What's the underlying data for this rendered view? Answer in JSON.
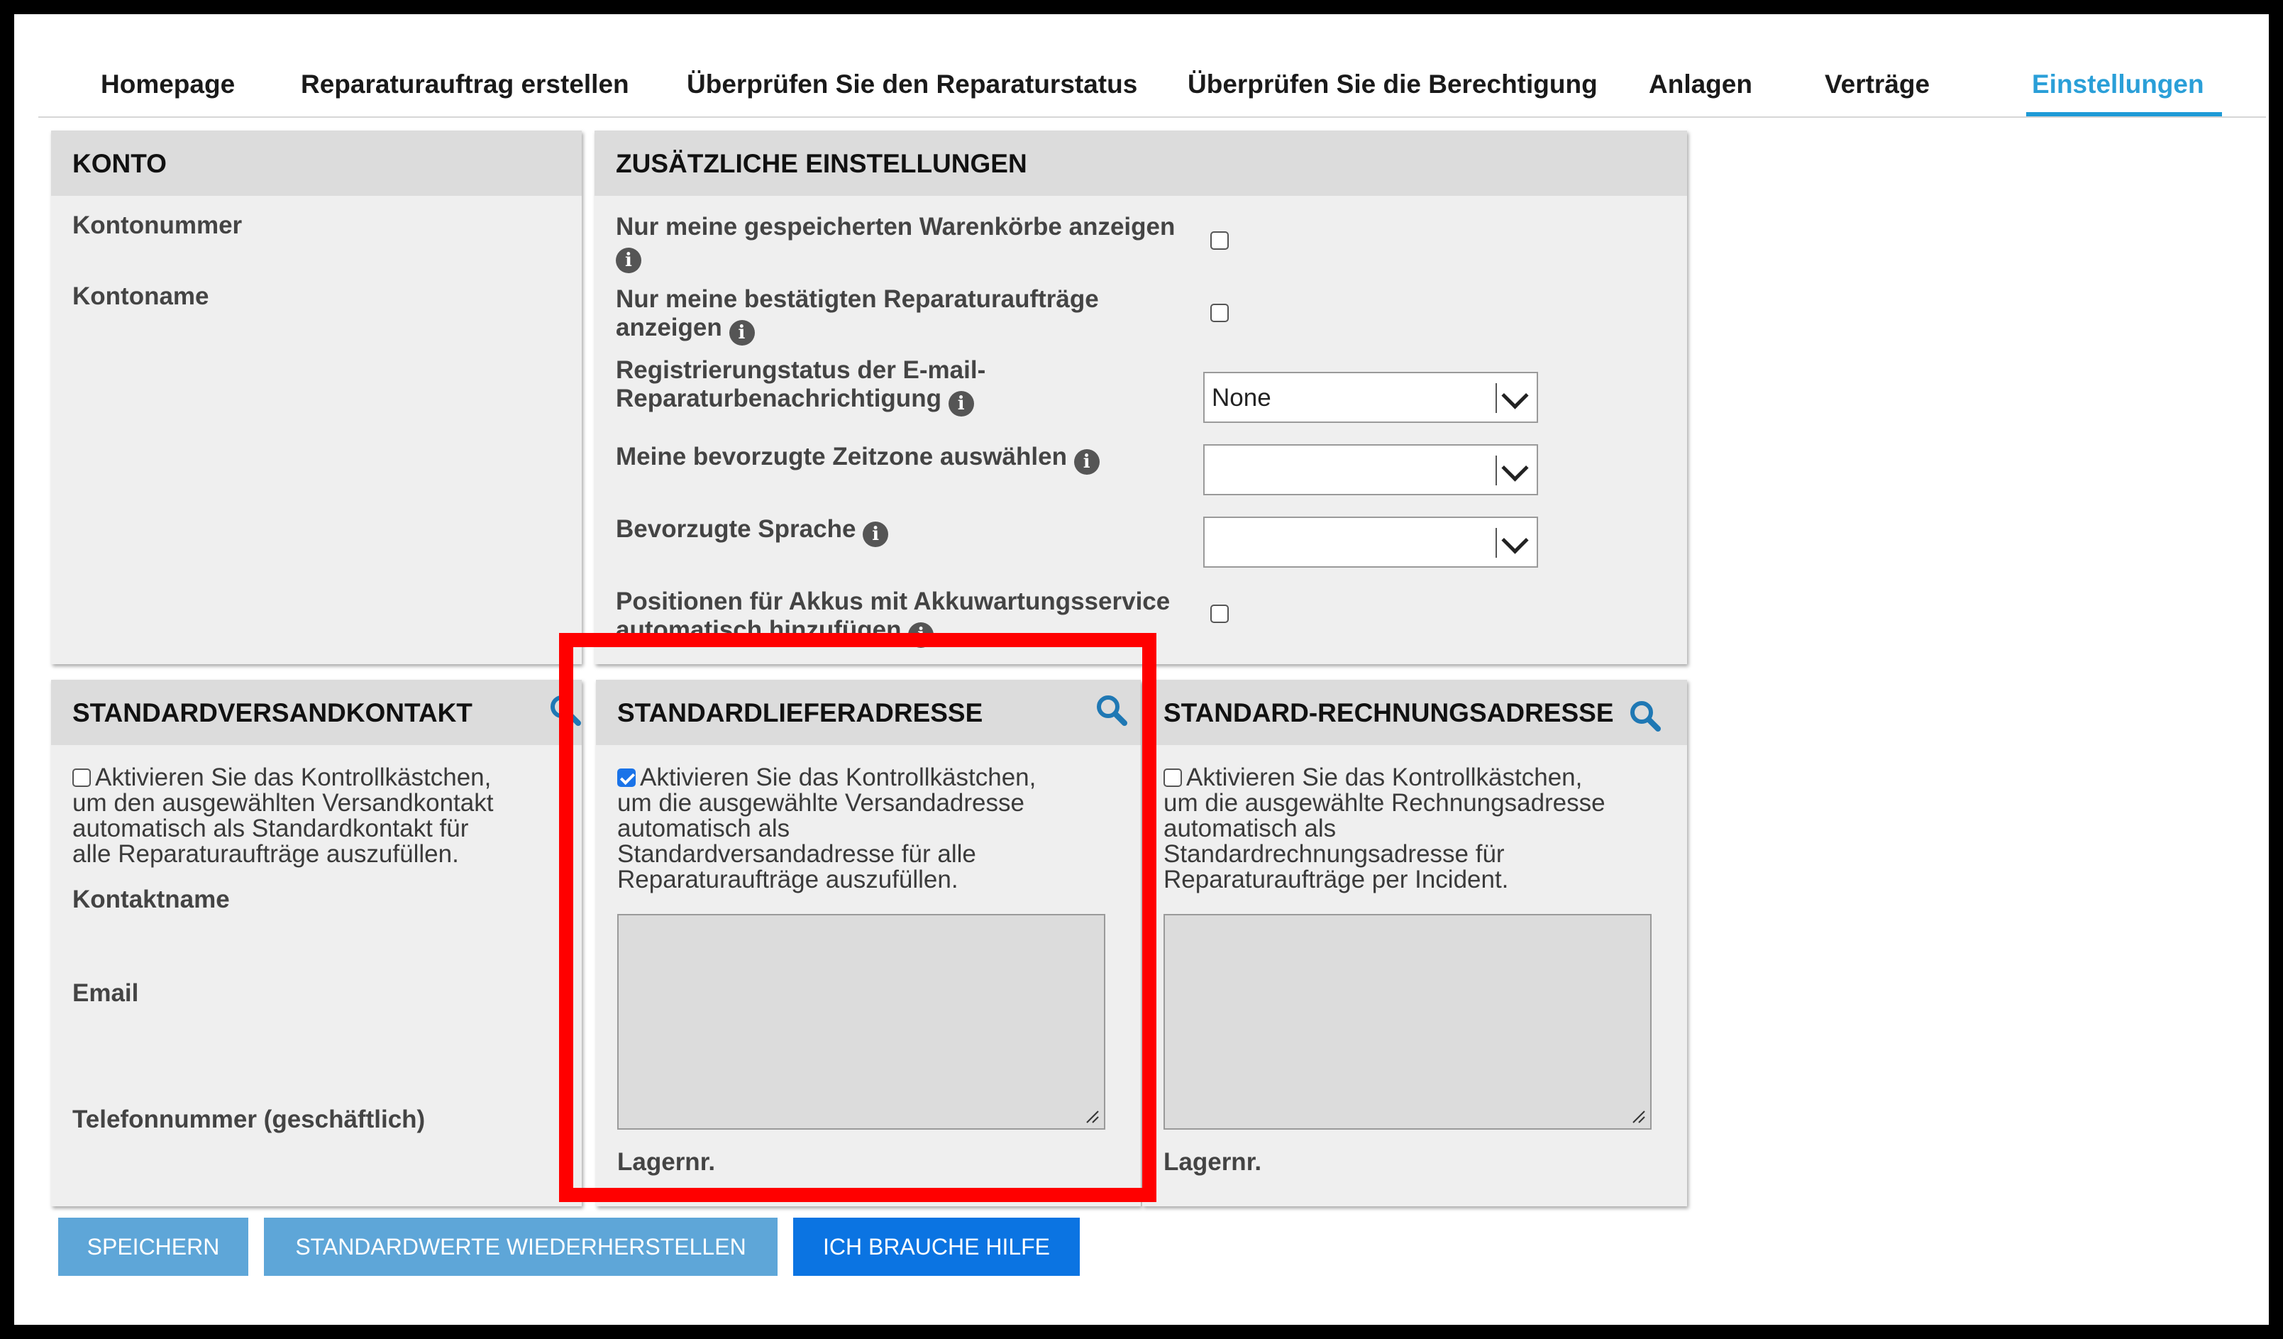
{
  "nav": {
    "tabs": [
      {
        "label": "Homepage"
      },
      {
        "label": "Reparaturauftrag erstellen"
      },
      {
        "label": "Überprüfen Sie den Reparaturstatus"
      },
      {
        "label": "Überprüfen Sie die Berechtigung"
      },
      {
        "label": "Anlagen"
      },
      {
        "label": "Verträge"
      },
      {
        "label": "Einstellungen"
      }
    ],
    "active_tab": "Einstellungen",
    "accent_color": "#1e9ad6"
  },
  "konto": {
    "title": "KONTO",
    "account_number_label": "Kontonummer",
    "account_name_label": "Kontoname"
  },
  "additional": {
    "title": "ZUSÄTZLICHE EINSTELLUNGEN",
    "saved_carts": {
      "label": "Nur meine gespeicherten Warenkörbe anzeigen",
      "checked": false
    },
    "confirmed_orders": {
      "label_line1": "Nur meine bestätigten Reparaturaufträge",
      "label_line2": "anzeigen",
      "checked": false
    },
    "email_notification": {
      "label_line1": "Registrierungstatus der E-mail-",
      "label_line2": "Reparaturbenachrichtigung",
      "value": "None"
    },
    "timezone": {
      "label": "Meine bevorzugte Zeitzone auswählen",
      "value": ""
    },
    "language": {
      "label": "Bevorzugte Sprache",
      "value": ""
    },
    "battery": {
      "label_line1": "Positionen für Akkus mit Akkuwartungsservice",
      "label_line2": "automatisch hinzufügen",
      "checked": false
    }
  },
  "shipping_contact": {
    "title": "STANDARDVERSANDKONTAKT",
    "checked": false,
    "desc_line1": "Aktivieren Sie das Kontrollkästchen,",
    "desc_line2": "um den ausgewählten Versandkontakt",
    "desc_line3": "automatisch als Standardkontakt für",
    "desc_line4": "alle Reparaturaufträge auszufüllen.",
    "contact_name_label": "Kontaktname",
    "email_label": "Email",
    "phone_label": "Telefonnummer (geschäftlich)"
  },
  "delivery_address": {
    "title": "STANDARDLIEFERADRESSE",
    "checked": true,
    "desc_line1": "Aktivieren Sie das Kontrollkästchen,",
    "desc_line2": "um die ausgewählte Versandadresse",
    "desc_line3": "automatisch als",
    "desc_line4": "Standardversandadresse für alle",
    "desc_line5": "Reparaturaufträge auszufüllen.",
    "address_value": "",
    "warehouse_label": "Lagernr."
  },
  "billing_address": {
    "title": "STANDARD-RECHNUNGSADRESSE",
    "checked": false,
    "desc_line1": "Aktivieren Sie das Kontrollkästchen,",
    "desc_line2": "um die ausgewählte Rechnungsadresse",
    "desc_line3": "automatisch als",
    "desc_line4": "Standardrechnungsadresse für",
    "desc_line5": "Reparaturaufträge per Incident.",
    "address_value": "",
    "warehouse_label": "Lagernr."
  },
  "buttons": {
    "save": "SPEICHERN",
    "restore": "STANDARDWERTE WIEDERHERSTELLEN",
    "help": "ICH BRAUCHE HILFE"
  },
  "info_glyph": "i",
  "colors": {
    "highlight": "#ff0000",
    "button_muted": "#5ea6d8",
    "button_primary": "#0b74e2",
    "search_icon": "#1f78b4"
  }
}
